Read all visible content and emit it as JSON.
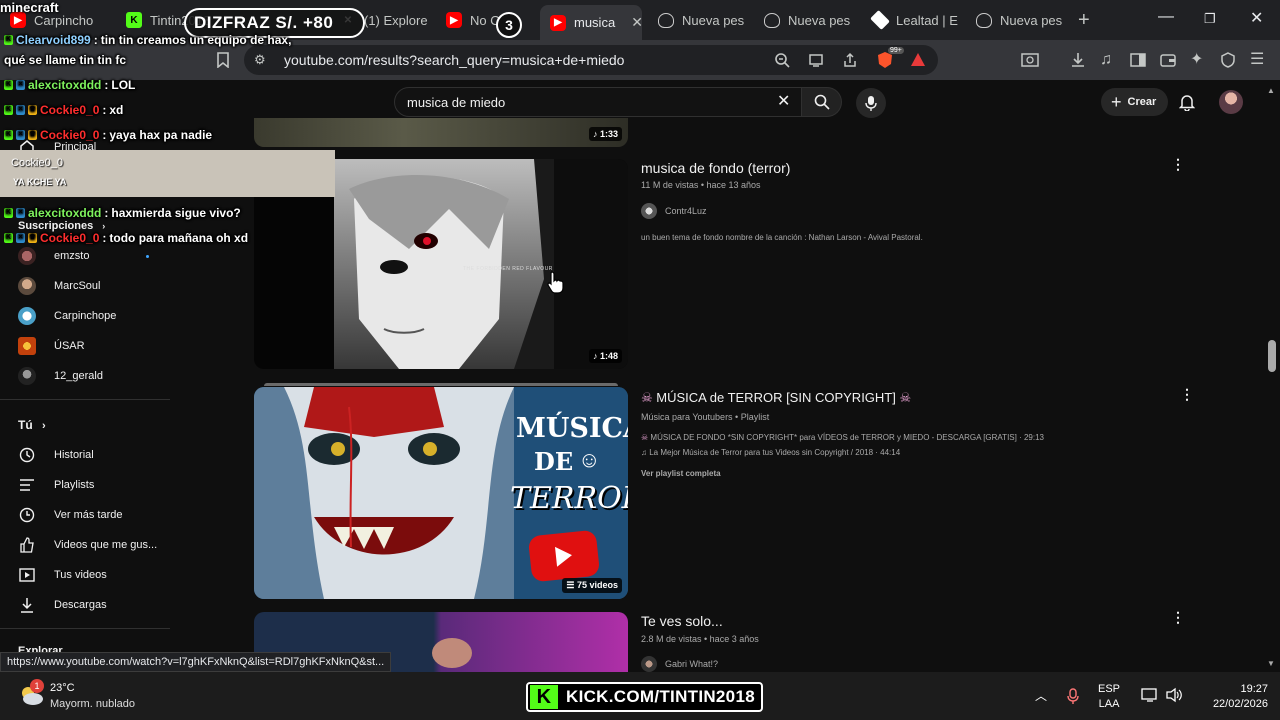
{
  "browser": {
    "tabs": [
      {
        "label": "Carpincho",
        "icon": "youtube-icon"
      },
      {
        "label": "Tintin2018",
        "icon": "kick-icon"
      },
      {
        "label": "(1) Explore",
        "icon": "x-icon"
      },
      {
        "label": "No Oth",
        "icon": "youtube-icon"
      },
      {
        "label": "musica",
        "icon": "youtube-icon",
        "active": true
      },
      {
        "label": "Nueva pes",
        "icon": "brave-icon"
      },
      {
        "label": "Nueva pes",
        "icon": "brave-icon"
      },
      {
        "label": "Lealtad | E",
        "icon": "diamond-icon"
      },
      {
        "label": "Nueva pes",
        "icon": "brave-icon"
      }
    ],
    "url": "youtube.com/results?search_query=musica+de+miedo",
    "shield_badge": "99+"
  },
  "youtube": {
    "search_query": "musica de miedo",
    "create_label": "Crear"
  },
  "sidebar": {
    "home_label": "Principal",
    "subs_header": "Suscripciones",
    "subscriptions": [
      "emzsto",
      "MarcSoul",
      "Carpinchope",
      "ÚSAR",
      "12_gerald"
    ],
    "you_header": "Tú",
    "you_items": [
      {
        "label": "Historial",
        "icon": "history-icon"
      },
      {
        "label": "Playlists",
        "icon": "playlists-icon"
      },
      {
        "label": "Ver más tarde",
        "icon": "watch-later-icon"
      },
      {
        "label": "Videos que me gus...",
        "icon": "like-icon"
      },
      {
        "label": "Tus videos",
        "icon": "your-videos-icon"
      },
      {
        "label": "Descargas",
        "icon": "downloads-icon"
      }
    ],
    "explore_header": "Explorar"
  },
  "results": [
    {
      "duration": "1:33"
    },
    {
      "title": "musica de fondo (terror)",
      "meta": "11 M de vistas • hace 13 años",
      "channel": "Contr4Luz",
      "description": "un buen tema de fondo nombre de la canción : Nathan Larson - Avival Pastoral.",
      "duration": "1:48",
      "thumb_text": "THE FORBIDDEN RED FLAVOUR"
    },
    {
      "title": "MÚSICA de TERROR [SIN COPYRIGHT]",
      "meta": "Música para Youtubers • Playlist",
      "line1": "MÚSICA DE FONDO *SIN COPYRIGHT* para VÍDEOS de TERROR y MIEDO - DESCARGA [GRATIS] · 29:13",
      "line2": "♫ La Mejor Música de Terror para tus Videos sin Copyright / 2018 · 44:14",
      "see_all": "Ver playlist completa",
      "thumb_word1": "MÚSICA",
      "thumb_word2": "DE",
      "thumb_word3": "TERROR",
      "count": "75 videos"
    },
    {
      "title": "Te ves solo...",
      "meta": "2.8 M de vistas • hace 3 años",
      "channel": "Gabri What!?"
    }
  ],
  "status_url": "https://www.youtube.com/watch?v=l7ghKFxNknQ&list=RDl7ghKFxNknQ&st...",
  "overlay": {
    "game": "minecraft",
    "donation": "DIZFRAZ S/. +80",
    "counter": "3",
    "chat": [
      {
        "user": "Clearvoid899",
        "msg": "tin tin creamos un equipo de hax,"
      },
      {
        "user": "",
        "msg": "qué se llame tin tin fc"
      },
      {
        "user": "alexcitoxddd",
        "msg": "LOL"
      },
      {
        "user": "Cockie0_0",
        "msg": "xd"
      },
      {
        "user": "Cockie0_0",
        "msg": "yaya hax pa nadie"
      },
      {
        "user": "alexcitoxddd",
        "msg": "haxmierda sigue vivo?"
      },
      {
        "user": "Cockie0_0",
        "msg": "todo para mañana oh xd"
      }
    ],
    "gif_user": "Cockie0_0",
    "gif_caption": "YA KCHE YA",
    "kick_banner": "KICK.COM/TINTIN2018"
  },
  "taskbar": {
    "temperature": "23°C",
    "weather": "Mayorm. nublado",
    "weather_badge": "1",
    "lang1": "ESP",
    "lang2": "LAA",
    "time": "19:27",
    "date": "22/02/2026"
  },
  "colors": {
    "youtube_red": "#ff0000",
    "kick_green": "#53fc18",
    "background": "#0f0f0f"
  }
}
